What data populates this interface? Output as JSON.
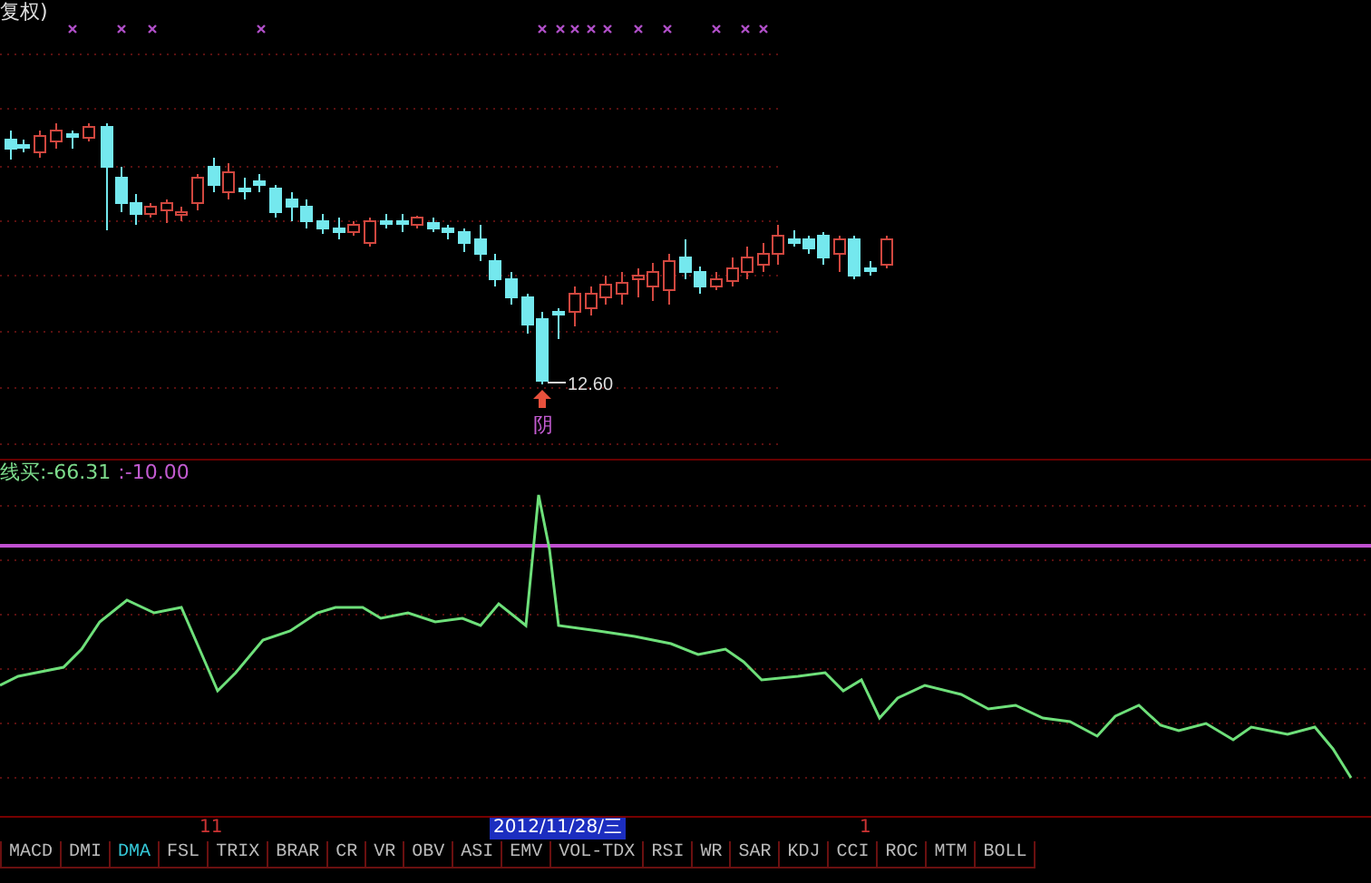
{
  "header": {
    "title": "复权)"
  },
  "price_chart": {
    "low_label": "12.60",
    "signal_label": "阴"
  },
  "indicator": {
    "name": "线买:-66.31",
    "threshold": ":-10.00"
  },
  "time_axis": [
    {
      "label": "11",
      "selected": false
    },
    {
      "label": "2012/11/28/三",
      "selected": true
    },
    {
      "label": "1",
      "selected": false
    }
  ],
  "tabs": [
    {
      "label": "MACD",
      "selected": false
    },
    {
      "label": "DMI",
      "selected": false
    },
    {
      "label": "DMA",
      "selected": true
    },
    {
      "label": "FSL",
      "selected": false
    },
    {
      "label": "TRIX",
      "selected": false
    },
    {
      "label": "BRAR",
      "selected": false
    },
    {
      "label": "CR",
      "selected": false
    },
    {
      "label": "VR",
      "selected": false
    },
    {
      "label": "OBV",
      "selected": false
    },
    {
      "label": "ASI",
      "selected": false
    },
    {
      "label": "EMV",
      "selected": false
    },
    {
      "label": "VOL-TDX",
      "selected": false
    },
    {
      "label": "RSI",
      "selected": false
    },
    {
      "label": "WR",
      "selected": false
    },
    {
      "label": "SAR",
      "selected": false
    },
    {
      "label": "KDJ",
      "selected": false
    },
    {
      "label": "CCI",
      "selected": false
    },
    {
      "label": "ROC",
      "selected": false
    },
    {
      "label": "MTM",
      "selected": false
    },
    {
      "label": "BOLL",
      "selected": false
    }
  ]
}
